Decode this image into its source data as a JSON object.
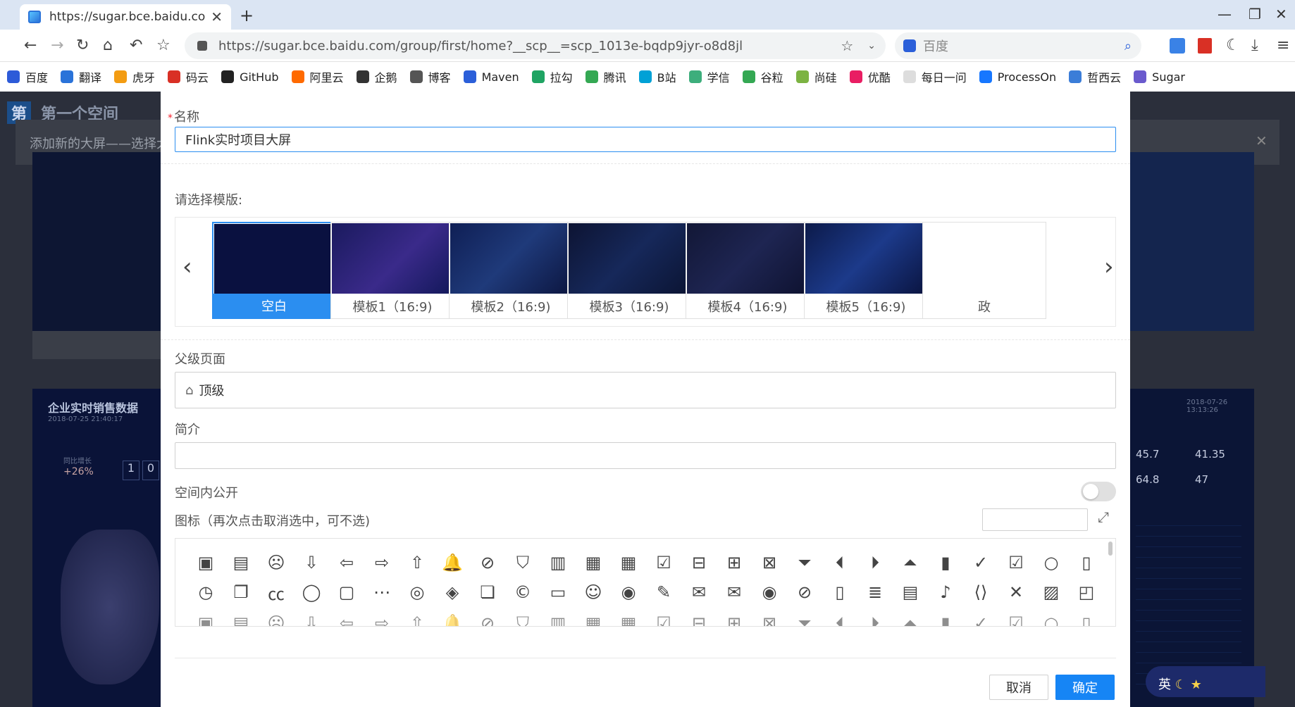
{
  "browser": {
    "tab_title": "https://sugar.bce.baidu.com/g",
    "url": "https://sugar.bce.baidu.com/group/first/home?__scp__=scp_1013e-bqdp9jyr-o8d8jl",
    "search_engine": "百度",
    "bookmarks": [
      "百度",
      "翻译",
      "虎牙",
      "码云",
      "GitHub",
      "阿里云",
      "企鹅",
      "博客",
      "Maven",
      "拉勾",
      "腾讯",
      "B站",
      "学信",
      "谷粒",
      "尚硅",
      "优酷",
      "每日一问",
      "ProcessOn",
      "哲西云",
      "Sugar"
    ]
  },
  "background": {
    "space_title": "第一个空间",
    "dialog_title": "添加新的大屏——选择大",
    "sales_title": "企业实时销售数据",
    "sales_date": "2018-07-25 21:40:17",
    "growth_label": "同比增长",
    "growth_value": "+26%",
    "counter": [
      "1",
      "0"
    ],
    "right_date": "2018-07-26 13:13:26",
    "right_stats": [
      "45.7",
      "41.35",
      "64.8",
      "47"
    ],
    "ime": "英"
  },
  "form": {
    "name_label": "名称",
    "name_value": "Flink实时项目大屏",
    "template_label": "请选择模版:",
    "templates": [
      {
        "caption": "空白"
      },
      {
        "caption": "模板1（16:9)"
      },
      {
        "caption": "模板2（16:9)"
      },
      {
        "caption": "模板3（16:9)"
      },
      {
        "caption": "模板4（16:9)"
      },
      {
        "caption": "模板5（16:9)"
      },
      {
        "caption": "政"
      }
    ],
    "parent_label": "父级页面",
    "parent_value": "顶级",
    "intro_label": "简介",
    "intro_value": "",
    "public_label": "空间内公开",
    "public_enabled": false,
    "icon_label": "图标（再次点击取消选中，可不选)",
    "icon_search_value": "",
    "cancel": "取消",
    "confirm": "确定"
  },
  "icons_row1": [
    "contact-book-icon",
    "id-card-icon",
    "frown-icon",
    "arrow-circle-down-icon",
    "arrow-circle-left-icon",
    "arrow-circle-right-icon",
    "arrow-circle-up-icon",
    "bell-icon",
    "bell-off-icon",
    "bookmark-icon",
    "building-icon",
    "calendar-icon",
    "calendar-grid-icon",
    "calendar-check-icon",
    "calendar-minus-icon",
    "calendar-plus-icon",
    "calendar-x-icon",
    "caret-square-down-icon",
    "caret-square-left-icon",
    "caret-square-right-icon",
    "caret-square-up-icon",
    "bar-chart-icon",
    "check-circle-icon",
    "check-square-icon",
    "circle-icon",
    "clipboard-icon"
  ],
  "icons_row2": [
    "clock-icon",
    "clone-icon",
    "closed-caption-icon",
    "comment-icon",
    "comment-square-icon",
    "comment-dots-icon",
    "comments-icon",
    "compass-icon",
    "copy-icon",
    "copyright-icon",
    "credit-card-icon",
    "dizzy-icon",
    "dot-circle-icon",
    "edit-icon",
    "envelope-icon",
    "envelope-open-icon",
    "eye-icon",
    "eye-slash-icon",
    "file-icon",
    "file-text-icon",
    "file-archive-icon",
    "file-audio-icon",
    "file-code-icon",
    "file-excel-icon",
    "file-image-icon",
    "file-pdf-icon"
  ],
  "accent": "#1685f5"
}
